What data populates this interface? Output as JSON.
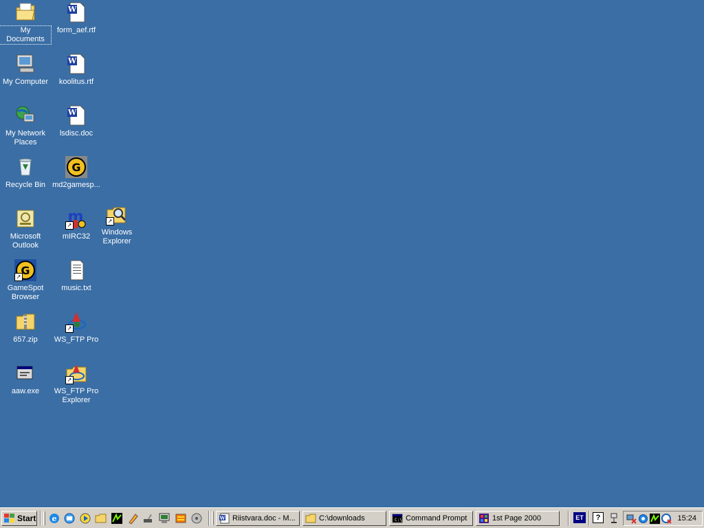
{
  "desktop": {
    "icons": [
      {
        "label": "My Documents"
      },
      {
        "label": "form_aef.rtf"
      },
      {
        "label": "My Computer"
      },
      {
        "label": "koolitus.rtf"
      },
      {
        "label": "My Network Places"
      },
      {
        "label": "lsdisc.doc"
      },
      {
        "label": "Recycle Bin"
      },
      {
        "label": "md2gamesp..."
      },
      {
        "label": "Microsoft Outlook"
      },
      {
        "label": "mIRC32"
      },
      {
        "label": "Windows Explorer"
      },
      {
        "label": "GameSpot Browser"
      },
      {
        "label": "music.txt"
      },
      {
        "label": "657.zip"
      },
      {
        "label": "WS_FTP Pro"
      },
      {
        "label": "aaw.exe"
      },
      {
        "label": "WS_FTP Pro Explorer"
      }
    ]
  },
  "taskbar": {
    "start_label": "Start",
    "tasks": [
      {
        "label": "Riistvara.doc - M..."
      },
      {
        "label": "C:\\downloads"
      },
      {
        "label": "Command Prompt"
      },
      {
        "label": "1st Page 2000"
      }
    ],
    "language": "ET",
    "help": "?",
    "clock": "15:24"
  },
  "colors": {
    "desktop_bg": "#3a6ea5",
    "taskbar_bg": "#d4d0c8"
  }
}
